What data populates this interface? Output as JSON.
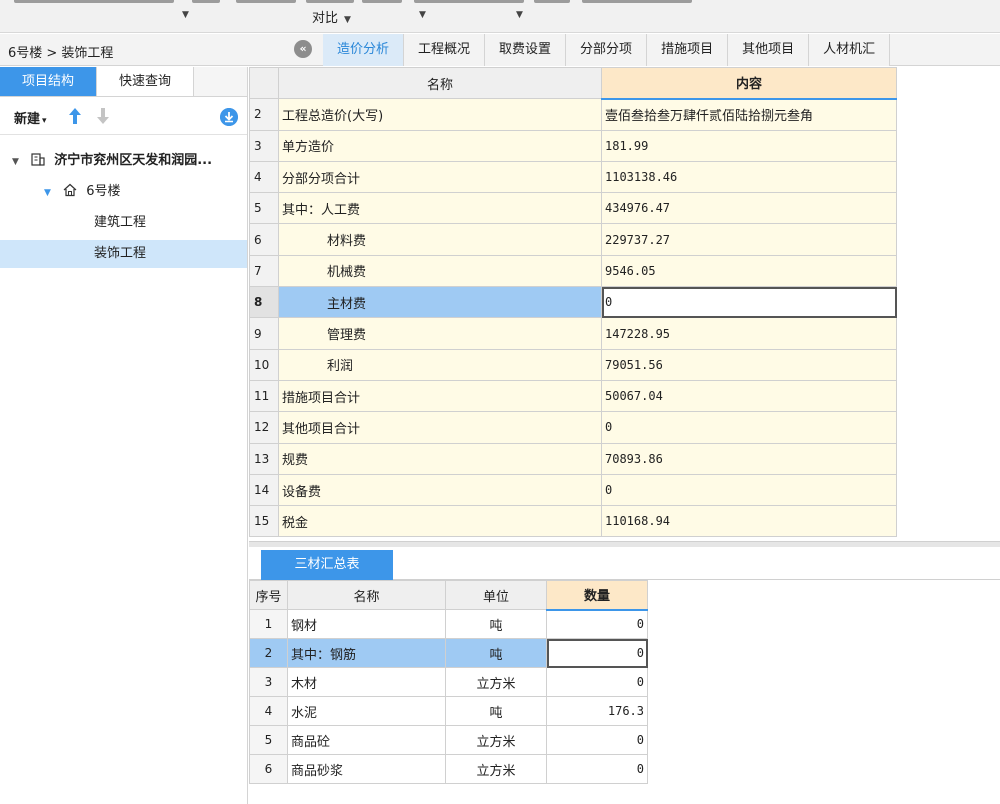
{
  "ribbon": {
    "compare_label": "对比"
  },
  "breadcrumb": "6号楼 > 装饰工程",
  "tabs": [
    {
      "label": "造价分析",
      "active": true
    },
    {
      "label": "工程概况",
      "active": false
    },
    {
      "label": "取费设置",
      "active": false
    },
    {
      "label": "分部分项",
      "active": false
    },
    {
      "label": "措施项目",
      "active": false
    },
    {
      "label": "其他项目",
      "active": false
    },
    {
      "label": "人材机汇",
      "active": false
    }
  ],
  "left_panel": {
    "tabs": [
      "项目结构",
      "快速查询"
    ],
    "new_label": "新建",
    "tree": [
      {
        "label": "济宁市兖州区天发和润园...",
        "level": 0,
        "icon": "building-icon"
      },
      {
        "label": "6号楼",
        "level": 1,
        "icon": "home-icon"
      },
      {
        "label": "建筑工程",
        "level": 2
      },
      {
        "label": "装饰工程",
        "level": 2,
        "selected": true
      }
    ]
  },
  "main_table": {
    "headers": [
      "名称",
      "内容"
    ],
    "rows": [
      {
        "idx": "2",
        "name": "工程总造价(大写)",
        "value": "壹佰叁拾叁万肆仟贰佰陆拾捌元叁角",
        "indent": false
      },
      {
        "idx": "3",
        "name": "单方造价",
        "value": "181.99",
        "indent": false
      },
      {
        "idx": "4",
        "name": "分部分项合计",
        "value": "1103138.46",
        "indent": false
      },
      {
        "idx": "5",
        "name": "其中：人工费",
        "value": "434976.47",
        "indent": false
      },
      {
        "idx": "6",
        "name": "材料费",
        "value": "229737.27",
        "indent": true
      },
      {
        "idx": "7",
        "name": "机械费",
        "value": "9546.05",
        "indent": true
      },
      {
        "idx": "8",
        "name": "主材费",
        "value": "0",
        "indent": true,
        "selected": true
      },
      {
        "idx": "9",
        "name": "管理费",
        "value": "147228.95",
        "indent": true
      },
      {
        "idx": "10",
        "name": "利润",
        "value": "79051.56",
        "indent": true
      },
      {
        "idx": "11",
        "name": "措施项目合计",
        "value": "50067.04",
        "indent": false
      },
      {
        "idx": "12",
        "name": "其他项目合计",
        "value": "0",
        "indent": false
      },
      {
        "idx": "13",
        "name": "规费",
        "value": "70893.86",
        "indent": false
      },
      {
        "idx": "14",
        "name": "设备费",
        "value": "0",
        "indent": false
      },
      {
        "idx": "15",
        "name": "税金",
        "value": "110168.94",
        "indent": false
      }
    ]
  },
  "bottom_panel": {
    "tab_label": "三材汇总表",
    "headers": [
      "序号",
      "名称",
      "单位",
      "数量"
    ],
    "rows": [
      {
        "idx": "1",
        "name": "钢材",
        "unit": "吨",
        "qty": "0"
      },
      {
        "idx": "2",
        "name": "其中：钢筋",
        "unit": "吨",
        "qty": "0",
        "selected": true
      },
      {
        "idx": "3",
        "name": "木材",
        "unit": "立方米",
        "qty": "0"
      },
      {
        "idx": "4",
        "name": "水泥",
        "unit": "吨",
        "qty": "176.3"
      },
      {
        "idx": "5",
        "name": "商品砼",
        "unit": "立方米",
        "qty": "0"
      },
      {
        "idx": "6",
        "name": "商品砂浆",
        "unit": "立方米",
        "qty": "0"
      }
    ]
  },
  "colors": {
    "accent": "#3d96e9",
    "selection": "#9fcaf3",
    "cell_bg": "#fffbe6",
    "header_highlight": "#fde8c8"
  }
}
